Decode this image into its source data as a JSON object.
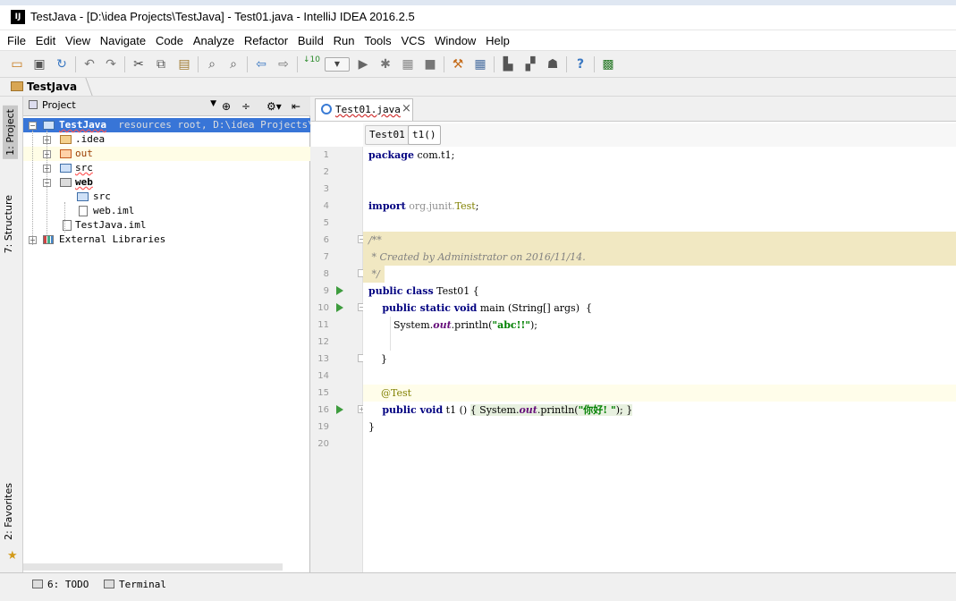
{
  "window": {
    "app_icon_text": "IJ",
    "title": "TestJava - [D:\\idea Projects\\TestJava] - Test01.java - IntelliJ IDEA 2016.2.5"
  },
  "menu": [
    "File",
    "Edit",
    "View",
    "Navigate",
    "Code",
    "Analyze",
    "Refactor",
    "Build",
    "Run",
    "Tools",
    "VCS",
    "Window",
    "Help"
  ],
  "toolbar": {
    "icons": [
      "open-folder-icon",
      "save-icon",
      "sync-icon",
      "undo-icon",
      "redo-icon",
      "cut-icon",
      "copy-icon",
      "paste-icon",
      "find-icon",
      "replace-icon",
      "back-icon",
      "forward-icon",
      "make-project-icon",
      "run-config-dropdown",
      "run-icon",
      "debug-icon",
      "coverage-icon",
      "stop-icon",
      "project-structure-icon",
      "settings-icon",
      "sdk-manager-icon",
      "avd-manager-icon",
      "android-icon",
      "help-icon",
      "plugin-icon"
    ]
  },
  "navbar": {
    "project": "TestJava"
  },
  "left_stripe": {
    "project_tab": "1: Project",
    "structure_tab": "7: Structure",
    "favorites_tab": "2: Favorites"
  },
  "project_panel": {
    "view_label": "Project",
    "tree": {
      "root_name": "TestJava",
      "root_suffix": "resources root,  D:\\idea Projects\\Tes",
      "idea": ".idea",
      "out": "out",
      "src": "src",
      "web": "web",
      "web_src": "src",
      "web_iml": "web.iml",
      "testjava_iml": "TestJava.iml",
      "external": "External Libraries"
    }
  },
  "editor": {
    "tab_label": "Test01.java",
    "breadcrumb_class": "Test01",
    "breadcrumb_method": "t1()",
    "line_numbers": [
      "1",
      "2",
      "3",
      "4",
      "5",
      "6",
      "7",
      "8",
      "9",
      "10",
      "11",
      "12",
      "13",
      "14",
      "15",
      "16",
      "19",
      "20"
    ],
    "code": {
      "l1_kw": "package",
      "l1_rest": " com.t1;",
      "l4_kw": "import",
      "l4_pkg": " org.junit.",
      "l4_cls": "Test",
      "l4_end": ";",
      "l6": "/**",
      "l7": " * Created by Administrator on 2016/11/14.",
      "l8": " */",
      "l9_kw": "public class",
      "l9_rest": " Test01 {",
      "l10_kw": "    public static void",
      "l10_rest": " main (String[] args)  {",
      "l11_pre": "        System.",
      "l11_fld": "out",
      "l11_mid": ".println(",
      "l11_str": "\"abc!!\"",
      "l11_end": ");",
      "l13": "    }",
      "l15": "    @Test",
      "l16_kw": "    public void",
      "l16_rest": " t1 () ",
      "l16_fold": "{ System.",
      "l16_fld": "out",
      "l16_mid": ".println(",
      "l16_str": "\"你好! \"",
      "l16_end": "); }",
      "l19": "}"
    }
  },
  "bottom": {
    "todo": "6: TODO",
    "terminal": "Terminal"
  }
}
